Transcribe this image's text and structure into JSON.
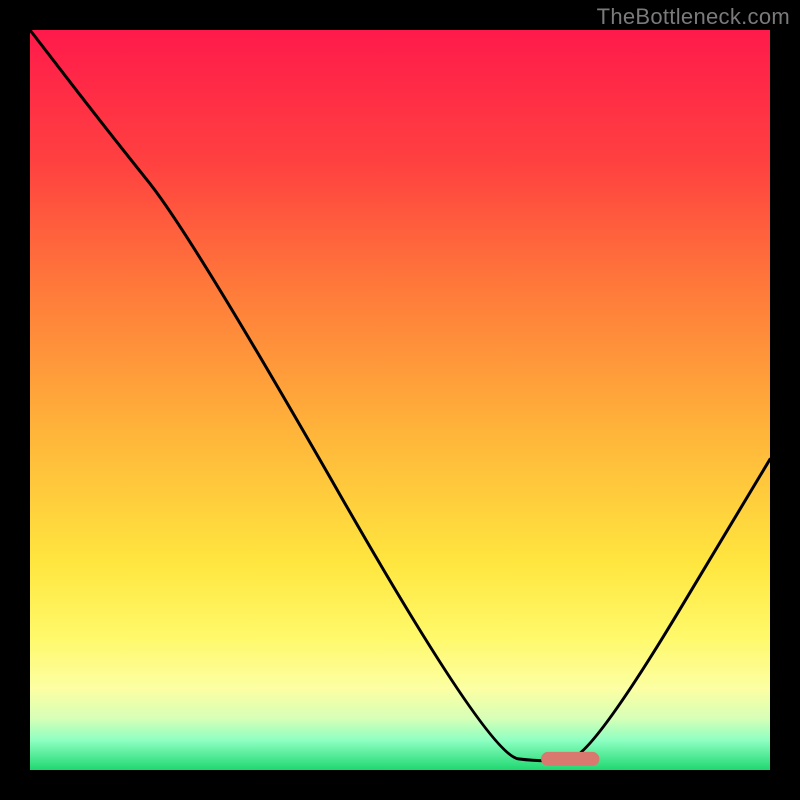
{
  "watermark": "TheBottleneck.com",
  "chart_data": {
    "type": "line",
    "title": "",
    "xlabel": "",
    "ylabel": "",
    "xlim": [
      0,
      100
    ],
    "ylim": [
      0,
      100
    ],
    "grid": false,
    "legend": false,
    "note": "Bottleneck-style V-curve over vertical rainbow gradient; axes unlabeled. Values are approximate positions inside the plot area (0–100 each axis, origin bottom-left).",
    "series": [
      {
        "name": "bottleneck-curve",
        "x": [
          0,
          10,
          22,
          62,
          70,
          76,
          100
        ],
        "y": [
          100,
          87,
          72,
          2,
          1,
          2,
          42
        ]
      }
    ],
    "highlight_segment": {
      "x": [
        70,
        76
      ],
      "y": [
        1.5,
        1.5
      ],
      "color": "#d9786f"
    },
    "gradient_stops": [
      {
        "offset": 0,
        "color": "#ff1a4b"
      },
      {
        "offset": 18,
        "color": "#ff4140"
      },
      {
        "offset": 35,
        "color": "#ff7a3a"
      },
      {
        "offset": 55,
        "color": "#ffb63a"
      },
      {
        "offset": 72,
        "color": "#ffe63f"
      },
      {
        "offset": 82,
        "color": "#fff96a"
      },
      {
        "offset": 89,
        "color": "#fcffa3"
      },
      {
        "offset": 93,
        "color": "#d7ffb7"
      },
      {
        "offset": 96,
        "color": "#8dffc2"
      },
      {
        "offset": 100,
        "color": "#1fd871"
      }
    ],
    "plot_background_outside": "#000000"
  }
}
